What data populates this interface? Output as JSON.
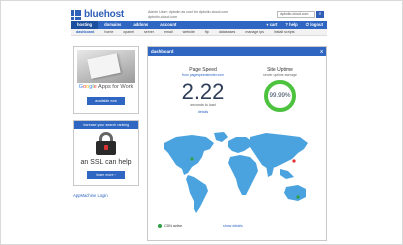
{
  "header": {
    "logo_text": "bluehost",
    "admin_line1": "Admin User: dpbolin as cust for dpbolin-cloud.com",
    "admin_line2": "dpbolin-cloud.com",
    "search_value": "dpbolin-cloud.com",
    "search_button_icon": "search-icon"
  },
  "main_nav": {
    "items": [
      "hosting",
      "domains",
      "addons",
      "account"
    ],
    "active": "hosting",
    "right_items": [
      "cart",
      "help",
      "logout"
    ]
  },
  "sub_nav": {
    "items": [
      "dashboard",
      "home",
      "cpanel",
      "server",
      "email",
      "website",
      "ftp",
      "databases",
      "manage ips",
      "install scripts"
    ],
    "active": "dashboard"
  },
  "ads": {
    "google": {
      "title_google": "Google",
      "title_rest": "Apps for Work",
      "button": "available now"
    },
    "ssl": {
      "banner": "increase your search ranking",
      "headline": "an SSL can help",
      "button": "learn more"
    }
  },
  "appmachine_link": "AppMachine Login",
  "dashboard": {
    "title": "dashboard",
    "close": "X",
    "page_speed": {
      "title": "Page Speed",
      "subtitle": "from pagespeedsender.com",
      "value": "2.22",
      "unit": "seconds to load",
      "details_link": "details"
    },
    "site_uptime": {
      "title": "Site Uptime",
      "subtitle": "server uptime average",
      "value": "99.99%",
      "percent": 99.99
    },
    "cdn_label": "CDN active",
    "show_details": "show details"
  },
  "colors": {
    "brand_blue": "#2e66c2",
    "uptime_green": "#4cc23f",
    "map_blue": "#4aa3df"
  }
}
